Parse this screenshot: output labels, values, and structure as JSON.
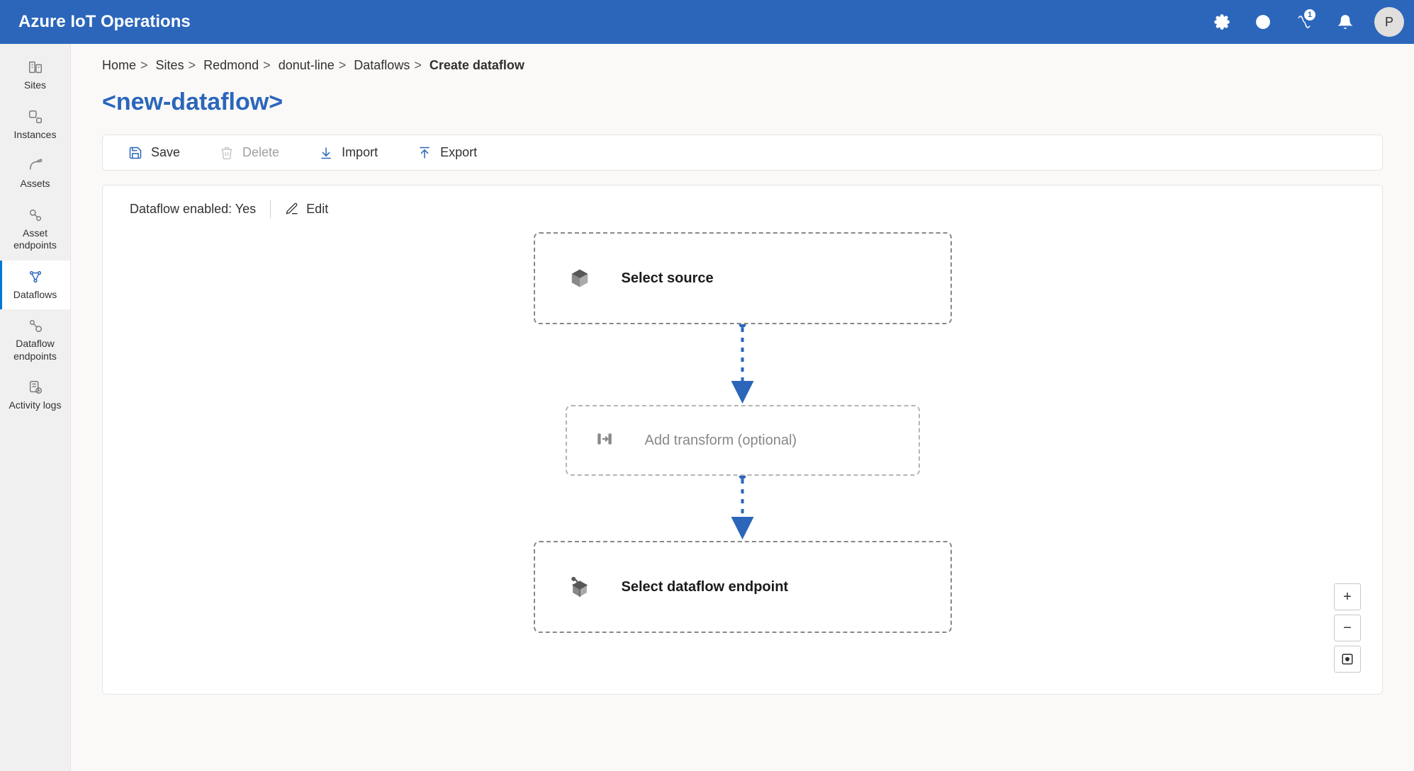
{
  "header": {
    "brand": "Azure IoT Operations",
    "notification_count": "1",
    "avatar_initial": "P"
  },
  "sidebar": {
    "items": [
      {
        "id": "sites",
        "label": "Sites"
      },
      {
        "id": "instances",
        "label": "Instances"
      },
      {
        "id": "assets",
        "label": "Assets"
      },
      {
        "id": "asset-endpoints",
        "label": "Asset endpoints"
      },
      {
        "id": "dataflows",
        "label": "Dataflows",
        "active": true
      },
      {
        "id": "dataflow-endpoints",
        "label": "Dataflow endpoints"
      },
      {
        "id": "activity-logs",
        "label": "Activity logs"
      }
    ]
  },
  "breadcrumb": {
    "items": [
      "Home",
      "Sites",
      "Redmond",
      "donut-line",
      "Dataflows"
    ],
    "current": "Create dataflow"
  },
  "page": {
    "title": "<new-dataflow>"
  },
  "toolbar": {
    "save": "Save",
    "delete": "Delete",
    "import": "Import",
    "export": "Export"
  },
  "canvas": {
    "enabled_label": "Dataflow enabled:",
    "enabled_value": "Yes",
    "edit": "Edit"
  },
  "flow": {
    "source": "Select source",
    "transform": "Add transform (optional)",
    "endpoint": "Select dataflow endpoint"
  },
  "zoom": {
    "in": "+",
    "out": "−"
  }
}
